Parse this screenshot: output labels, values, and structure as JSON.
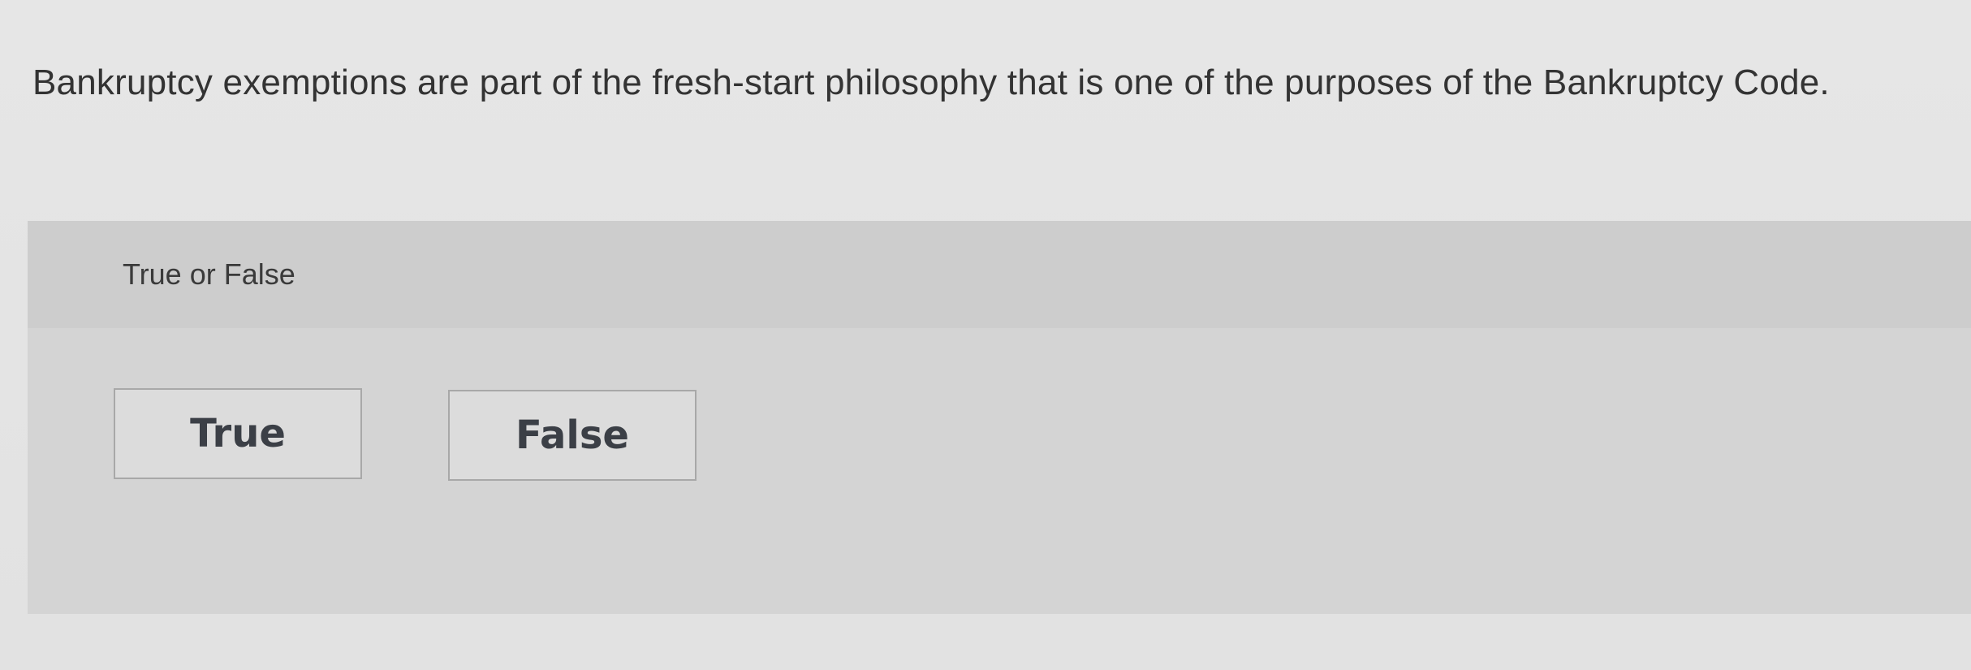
{
  "question": {
    "text": "Bankruptcy exemptions are part of the fresh-start philosophy that is one of the purposes of the Bankruptcy Code."
  },
  "answer_panel": {
    "prompt": "True or False",
    "choices": [
      {
        "label": "True"
      },
      {
        "label": "False"
      }
    ]
  },
  "colors": {
    "page_background": "#e4e4e4",
    "panel_background": "#d4d4d4",
    "panel_header_background": "#cdcdcd",
    "button_border": "#a8a8a8",
    "button_text": "#3b3f46"
  }
}
